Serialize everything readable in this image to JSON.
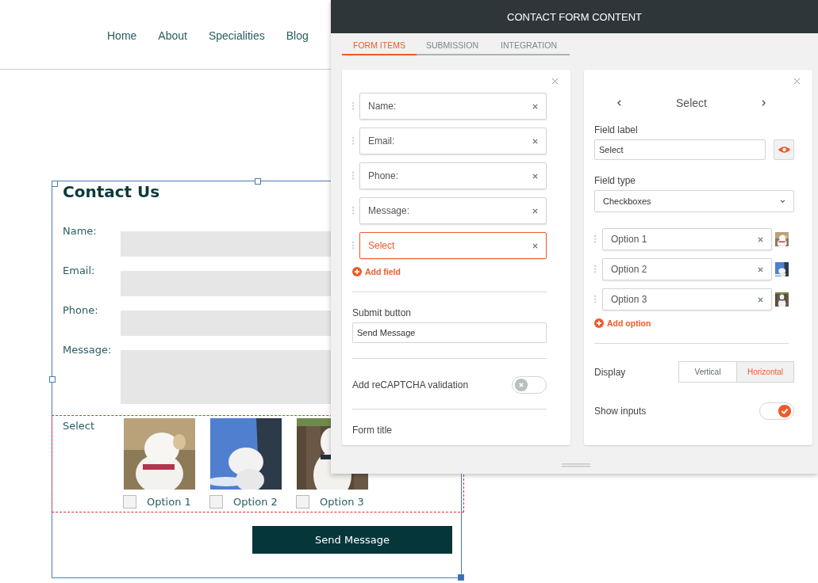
{
  "site": {
    "nav": [
      "Home",
      "About",
      "Specialities",
      "Blog"
    ],
    "form": {
      "title": "Contact Us",
      "fields": [
        {
          "label": "Name:",
          "kind": "line"
        },
        {
          "label": "Email:",
          "kind": "line"
        },
        {
          "label": "Phone:",
          "kind": "line"
        },
        {
          "label": "Message:",
          "kind": "area"
        }
      ],
      "select": {
        "label": "Select",
        "options": [
          {
            "label": "Option 1",
            "checked": false
          },
          {
            "label": "Option 2",
            "checked": false
          },
          {
            "label": "Option 3",
            "checked": false
          }
        ]
      },
      "submit": "Send Message"
    }
  },
  "panel": {
    "title": "CONTACT FORM CONTENT",
    "tabs": [
      {
        "label": "FORM ITEMS",
        "selected": true
      },
      {
        "label": "SUBMISSION",
        "selected": false
      },
      {
        "label": "INTEGRATION",
        "selected": false
      }
    ],
    "items": [
      {
        "label": "Name:",
        "selected": false
      },
      {
        "label": "Email:",
        "selected": false
      },
      {
        "label": "Phone:",
        "selected": false
      },
      {
        "label": "Message:",
        "selected": false
      },
      {
        "label": "Select",
        "selected": true
      }
    ],
    "add_field": "Add field",
    "submit_label": "Submit button",
    "submit_value": "Send Message",
    "recaptcha": {
      "label": "Add reCAPTCHA validation",
      "on": false
    },
    "form_title_label": "Form title",
    "editor": {
      "title": "Select",
      "field_label": "Field label",
      "field_label_value": "Select",
      "visible": true,
      "field_type_label": "Field type",
      "field_type": "Checkboxes",
      "options": [
        "Option 1",
        "Option 2",
        "Option 3"
      ],
      "add_option": "Add option",
      "display_label": "Display",
      "display": [
        {
          "label": "Vertical",
          "selected": false
        },
        {
          "label": "Horizontal",
          "selected": true
        }
      ],
      "show_inputs": {
        "label": "Show inputs",
        "on": true
      }
    }
  }
}
